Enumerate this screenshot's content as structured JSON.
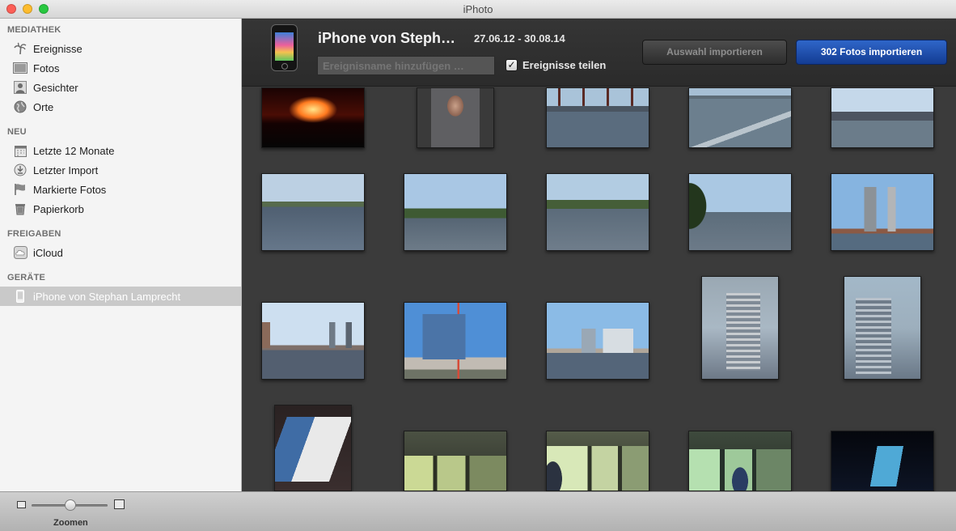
{
  "window": {
    "title": "iPhoto"
  },
  "sidebar": {
    "sections": [
      {
        "heading": "MEDIATHEK",
        "items": [
          {
            "label": "Ereignisse",
            "icon": "palm-tree-icon"
          },
          {
            "label": "Fotos",
            "icon": "photo-icon"
          },
          {
            "label": "Gesichter",
            "icon": "person-icon"
          },
          {
            "label": "Orte",
            "icon": "globe-icon"
          }
        ]
      },
      {
        "heading": "NEU",
        "items": [
          {
            "label": "Letzte 12 Monate",
            "icon": "calendar-icon"
          },
          {
            "label": "Letzter Import",
            "icon": "import-icon"
          },
          {
            "label": "Markierte Fotos",
            "icon": "flag-icon"
          },
          {
            "label": "Papierkorb",
            "icon": "trash-icon"
          }
        ]
      },
      {
        "heading": "FREIGABEN",
        "items": [
          {
            "label": "iCloud",
            "icon": "cloud-icon"
          }
        ]
      },
      {
        "heading": "GERÄTE",
        "items": [
          {
            "label": "iPhone von Stephan Lamprecht",
            "icon": "iphone-icon",
            "selected": true
          }
        ]
      }
    ]
  },
  "import_header": {
    "device_name": "iPhone von Steph…",
    "date_range": "27.06.12 - 30.08.14",
    "event_name_placeholder": "Ereignisname hinzufügen …",
    "share_events_label": "Ereignisse teilen",
    "share_events_checked": true,
    "import_selection_label": "Auswahl importieren",
    "import_all_label": "302 Fotos importieren"
  },
  "thumbnails": [
    {
      "scene": "concert",
      "orientation": "landscape"
    },
    {
      "scene": "person",
      "orientation": "landscape"
    },
    {
      "scene": "harbor-cranes",
      "orientation": "landscape"
    },
    {
      "scene": "harbor-railing",
      "orientation": "landscape"
    },
    {
      "scene": "harbor-cranes-far",
      "orientation": "landscape"
    },
    {
      "scene": "river",
      "orientation": "landscape"
    },
    {
      "scene": "river",
      "orientation": "landscape"
    },
    {
      "scene": "river",
      "orientation": "landscape"
    },
    {
      "scene": "river-bank",
      "orientation": "landscape"
    },
    {
      "scene": "city-towers",
      "orientation": "landscape"
    },
    {
      "scene": "city-skyline",
      "orientation": "landscape"
    },
    {
      "scene": "elbphilharmonie",
      "orientation": "landscape"
    },
    {
      "scene": "modern-buildings",
      "orientation": "landscape"
    },
    {
      "scene": "sign-list",
      "orientation": "portrait"
    },
    {
      "scene": "sign-list",
      "orientation": "portrait"
    },
    {
      "scene": "tickets",
      "orientation": "portrait"
    },
    {
      "scene": "tunnel",
      "orientation": "landscape"
    },
    {
      "scene": "tunnel-child",
      "orientation": "landscape"
    },
    {
      "scene": "tunnel-child",
      "orientation": "landscape"
    },
    {
      "scene": "tunnel-dark",
      "orientation": "landscape"
    }
  ],
  "bottom_bar": {
    "zoom_label": "Zoomen",
    "zoom_level": 0.5
  },
  "colors": {
    "import_all_button": "#1f4fae",
    "content_bg": "#3b3b3b",
    "sidebar_bg": "#f4f4f4"
  }
}
